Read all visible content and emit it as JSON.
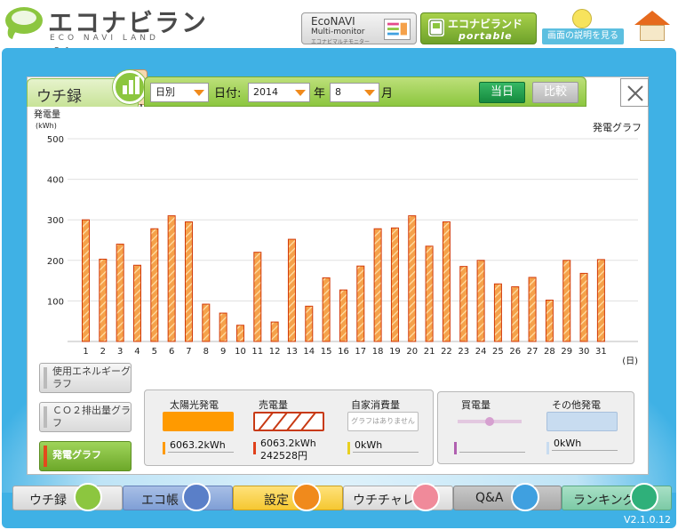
{
  "header": {
    "logo_jp": "エコナビランド",
    "logo_en": "ECO NAVI LAND",
    "econavi_btn": {
      "line1": "EcoNAVI",
      "line2": "Multi-monitor",
      "line3": "エコナビマルチモニター"
    },
    "portable_btn": {
      "line1": "エコナビランド",
      "line2": "portable"
    },
    "help_btn": "画面の説明を見る"
  },
  "panel": {
    "tab_label": "ウチ録",
    "denki_tab": "電 kW",
    "mode_select": "日別",
    "date_label": "日付:",
    "year_value": "2014",
    "year_unit": "年",
    "month_value": "8",
    "month_unit": "月",
    "today_button": "当日",
    "compare_button": "比較"
  },
  "chart_data": {
    "type": "bar",
    "title": "発電グラフ",
    "ylabel": "発電量",
    "yunit": "(kWh)",
    "xunit": "(日)",
    "ylim": [
      0,
      500
    ],
    "yticks": [
      100,
      200,
      300,
      400,
      500
    ],
    "grid": true,
    "categories": [
      "1",
      "2",
      "3",
      "4",
      "5",
      "6",
      "7",
      "8",
      "9",
      "10",
      "11",
      "12",
      "13",
      "14",
      "15",
      "16",
      "17",
      "18",
      "19",
      "20",
      "21",
      "22",
      "23",
      "24",
      "25",
      "26",
      "27",
      "28",
      "29",
      "30",
      "31"
    ],
    "values": [
      300,
      203,
      240,
      188,
      278,
      310,
      295,
      92,
      70,
      40,
      220,
      48,
      252,
      87,
      157,
      127,
      186,
      278,
      280,
      310,
      235,
      295,
      185,
      200,
      142,
      135,
      158,
      102,
      200,
      168,
      202
    ],
    "colors": {
      "fill": "#f5a14a",
      "stroke": "#d23a0a",
      "hatch": "#ffe0a8"
    }
  },
  "side": {
    "energy": "使用エネルギーグラフ",
    "co2": "ＣＯ２排出量グラフ",
    "hatsuden": "発電グラフ"
  },
  "legend": {
    "solar": {
      "title": "太陽光発電",
      "value": "6063.2kWh",
      "color": "#ff9a00"
    },
    "sold": {
      "title": "売電量",
      "value1": "6063.2kWh",
      "value2": "242528円",
      "color": "#e0401a"
    },
    "self": {
      "title": "自家消費量",
      "no_graph": "グラフはありません",
      "value": "0kWh",
      "color": "#e8d020"
    },
    "bought": {
      "title": "買電量",
      "value": "",
      "color": "#b060b0"
    },
    "other": {
      "title": "その他発電",
      "value": "0kWh",
      "color": "#c8dcf0"
    }
  },
  "nav": {
    "uchiroku": "ウチ録",
    "ecocho": "エコ帳",
    "settei": "設定",
    "chare": "ウチチャレ",
    "qa": "Q&A",
    "rank": "ランキング"
  },
  "version": "V2.1.0.12"
}
